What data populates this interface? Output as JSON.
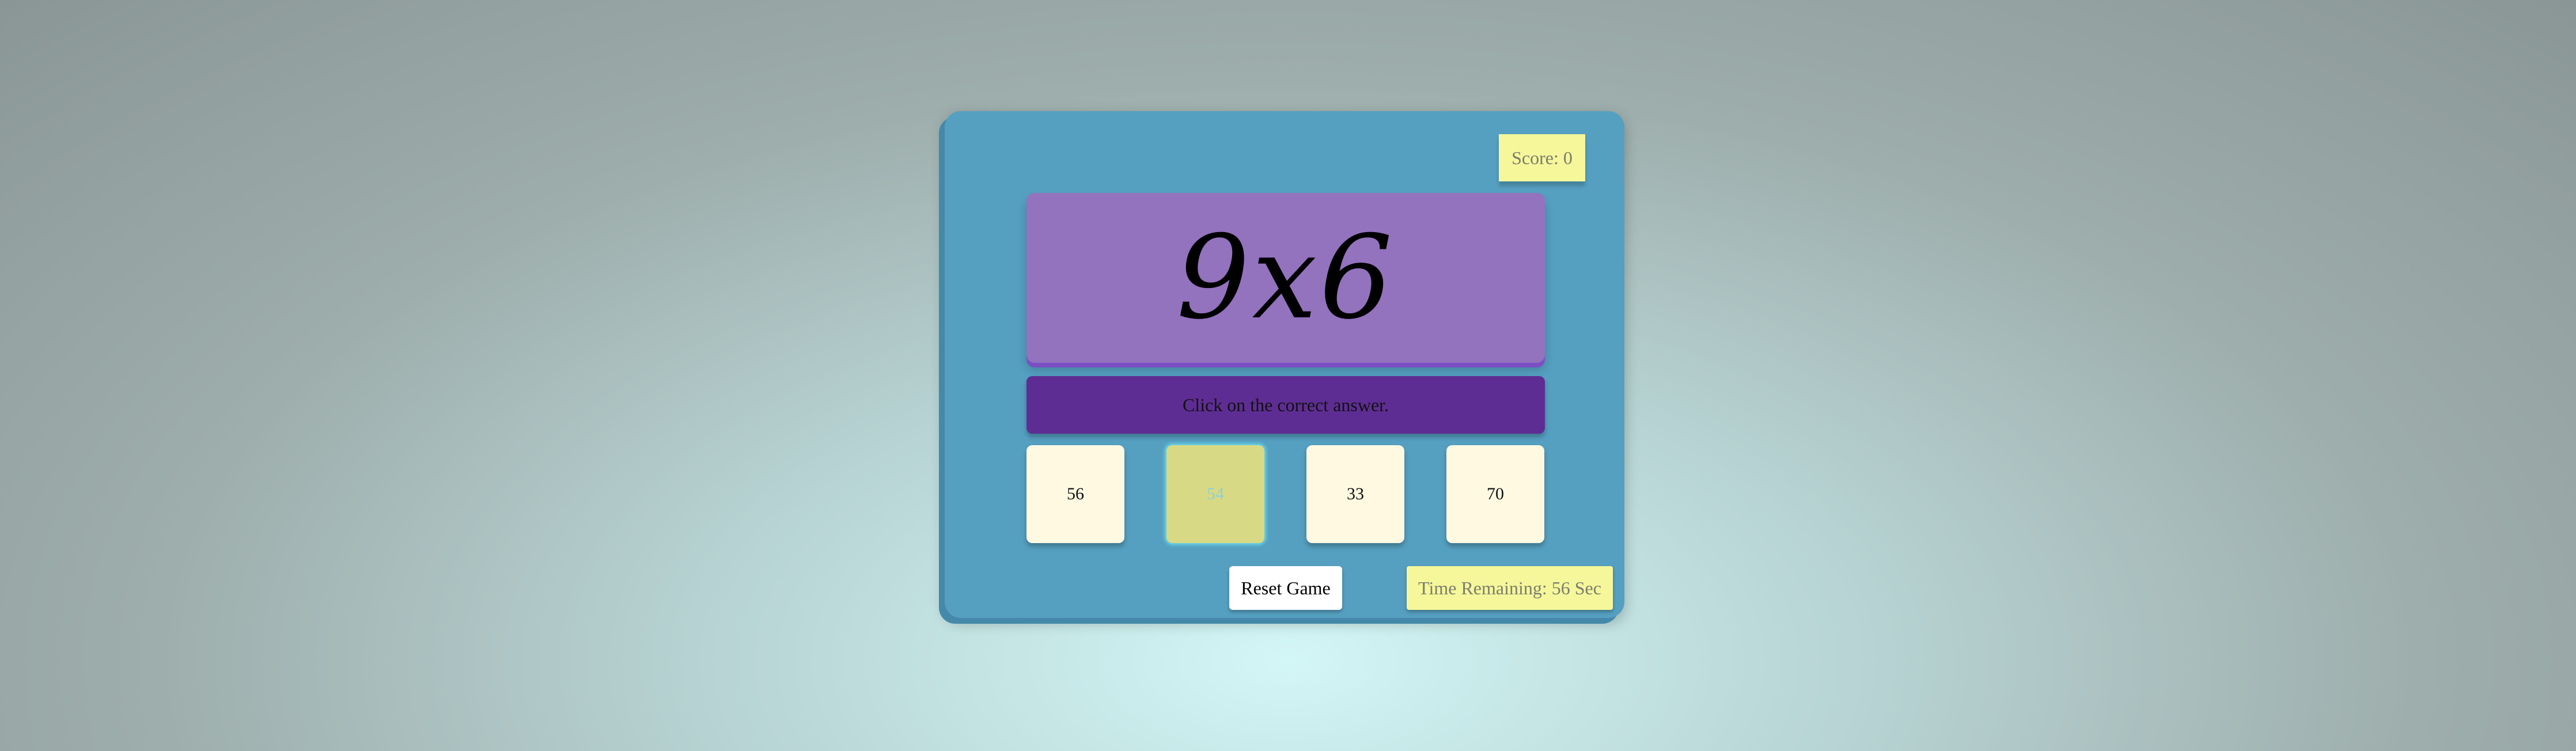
{
  "game": {
    "score_label": "Score: 0",
    "question": "9x6",
    "instruction": "Click on the correct answer.",
    "choices": [
      "56",
      "54",
      "33",
      "70"
    ],
    "reset_label": "Reset Game",
    "timer_label": "Time Remaining: 56 Sec"
  },
  "colors": {
    "panel": "#559fc0",
    "question_box": "#9372be",
    "instruction_box": "#5e2d93",
    "choice_box": "#fff9e2",
    "choice_hover": "#d8d985",
    "highlight_box": "#f6f79a"
  }
}
